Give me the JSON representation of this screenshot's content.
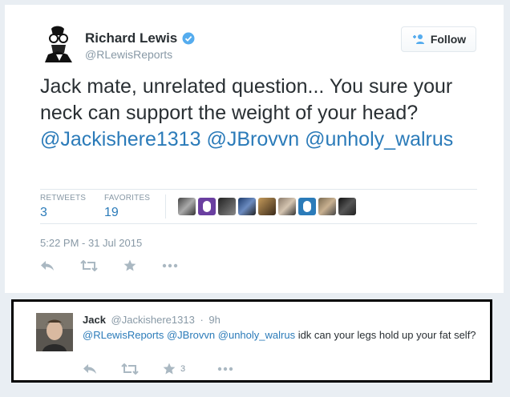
{
  "tweet": {
    "name": "Richard Lewis",
    "handle": "@RLewisReports",
    "follow_label": "Follow",
    "text_1": "Jack mate, unrelated question... You sure your neck can support the weight of your head? ",
    "mention_1": "@Jackishere1313",
    "mention_2": "@JBrovvn",
    "mention_3": "@unholy_walrus",
    "retweets_label": "RETWEETS",
    "retweets_count": "3",
    "favorites_label": "FAVORITES",
    "favorites_count": "19",
    "timestamp": "5:22 PM - 31 Jul 2015",
    "colors": {
      "link": "#2b7bb9",
      "verified": "#55acee",
      "muted": "#8899a6"
    }
  },
  "reply": {
    "name": "Jack",
    "handle": "@Jackishere1313",
    "age": "9h",
    "mention_1": "@RLewisReports",
    "mention_2": "@JBrovvn",
    "mention_3": "@unholy_walrus",
    "text": " idk can your legs hold up your fat self?",
    "favorites_count": "3"
  },
  "icons": [
    "reply-icon",
    "retweet-icon",
    "favorite-icon",
    "more-icon",
    "follow-user-icon",
    "verified-icon"
  ]
}
